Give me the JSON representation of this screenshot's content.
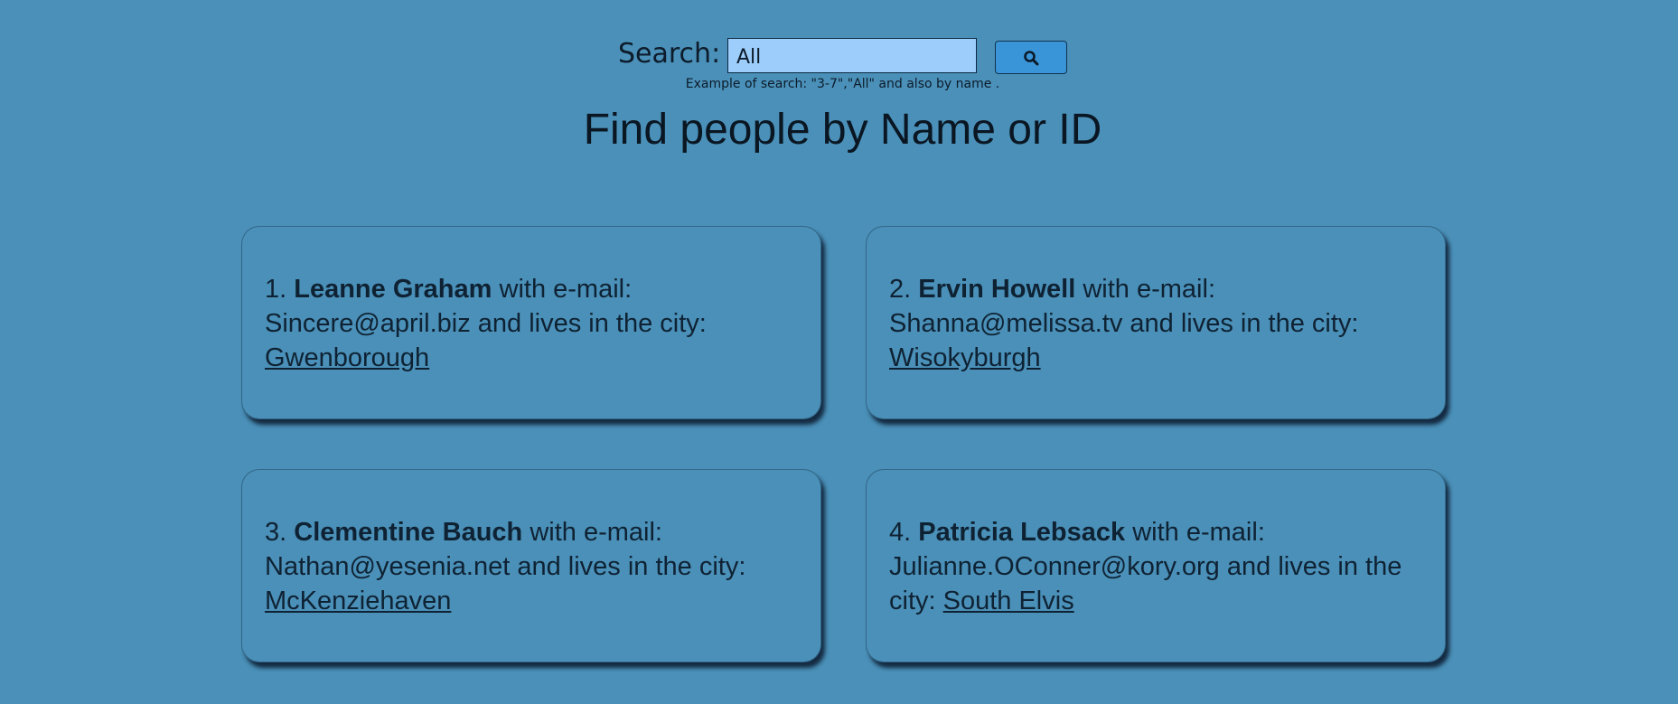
{
  "search": {
    "label": "Search:",
    "value": "All",
    "hint": "Example of search: \"3-7\",\"All\" and also by name ."
  },
  "page_title": "Find people by Name or ID",
  "colors": {
    "background": "#4a90b8",
    "input_background": "#9dcdfa",
    "button_background": "#3a95d8"
  },
  "icons": {
    "search_button": "search-icon"
  },
  "people": [
    {
      "number": "1.",
      "name": "Leanne Graham",
      "email_prefix": "with e-mail:",
      "email": "Sincere@april.biz",
      "city_prefix": "and lives in the city:",
      "city": "Gwenborough"
    },
    {
      "number": "2.",
      "name": "Ervin Howell",
      "email_prefix": "with e-mail:",
      "email": "Shanna@melissa.tv",
      "city_prefix": "and lives in the city:",
      "city": "Wisokyburgh"
    },
    {
      "number": "3.",
      "name": "Clementine Bauch",
      "email_prefix": "with e-mail:",
      "email": "Nathan@yesenia.net",
      "city_prefix": "and lives in the city:",
      "city": "McKenziehaven"
    },
    {
      "number": "4.",
      "name": "Patricia Lebsack",
      "email_prefix": "with e-mail:",
      "email": "Julianne.OConner@kory.org",
      "city_prefix": "and lives in the city:",
      "city": "South Elvis"
    }
  ]
}
